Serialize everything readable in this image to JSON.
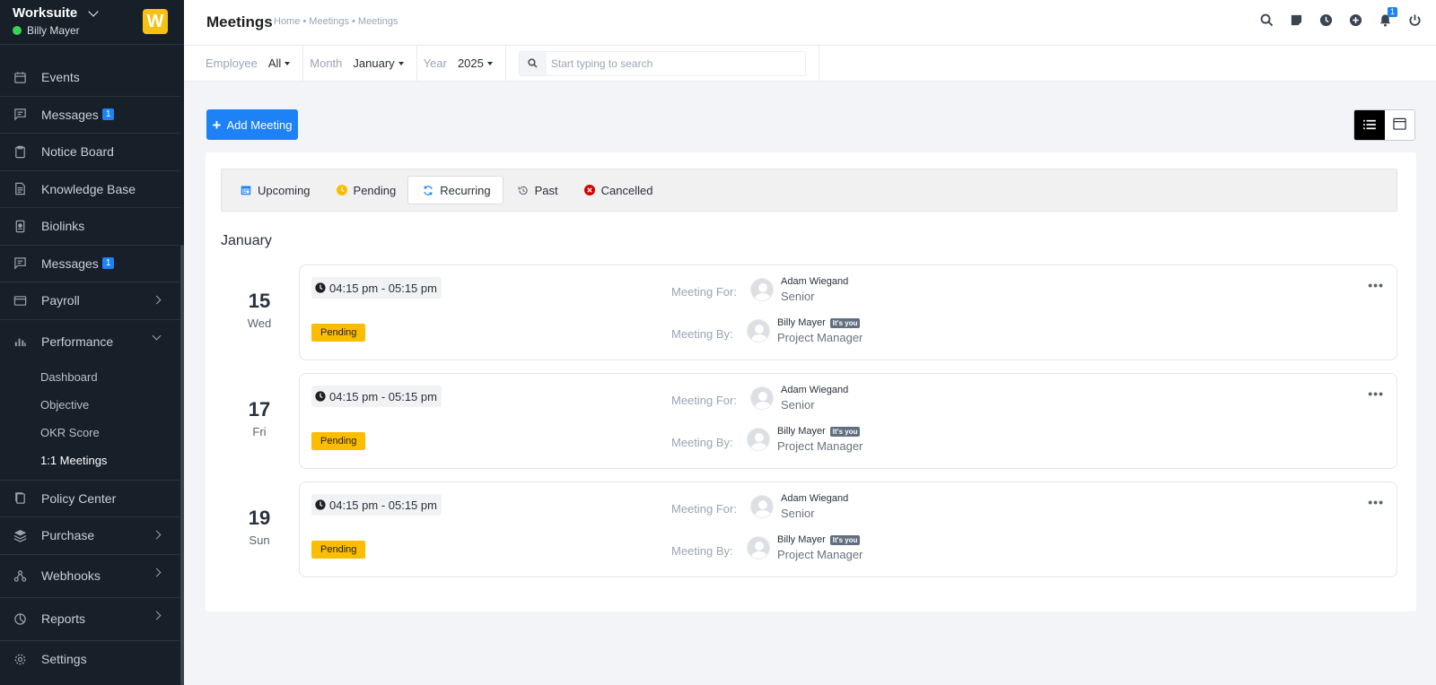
{
  "sidebar": {
    "brand": "Worksuite",
    "user": "Billy Mayer",
    "logo_letter": "W",
    "items": [
      {
        "label": "Events",
        "icon": "calendar-icon"
      },
      {
        "label": "Messages",
        "icon": "message-icon",
        "badge": "1"
      },
      {
        "label": "Notice Board",
        "icon": "clipboard-icon"
      },
      {
        "label": "Knowledge Base",
        "icon": "document-icon"
      },
      {
        "label": "Biolinks",
        "icon": "id-card-icon"
      },
      {
        "label": "Messages",
        "icon": "message-icon",
        "badge": "1"
      },
      {
        "label": "Payroll",
        "icon": "wallet-icon"
      },
      {
        "label": "Performance",
        "icon": "bar-chart-icon"
      },
      {
        "label": "Policy Center",
        "icon": "copy-icon"
      },
      {
        "label": "Purchase",
        "icon": "layers-icon"
      },
      {
        "label": "Webhooks",
        "icon": "webhook-icon"
      },
      {
        "label": "Reports",
        "icon": "pie-chart-icon"
      },
      {
        "label": "Settings",
        "icon": "gear-icon"
      }
    ],
    "performance_sub": [
      "Dashboard",
      "Objective",
      "OKR Score",
      "1:1 Meetings"
    ]
  },
  "header": {
    "title": "Meetings",
    "breadcrumb": "Home • Meetings • Meetings",
    "notification_count": "1"
  },
  "filters": {
    "employee_label": "Employee",
    "employee_value": "All",
    "month_label": "Month",
    "month_value": "January",
    "year_label": "Year",
    "year_value": "2025",
    "search_placeholder": "Start typing to search"
  },
  "actions": {
    "add_meeting": "Add Meeting"
  },
  "tabs": [
    "Upcoming",
    "Pending",
    "Recurring",
    "Past",
    "Cancelled"
  ],
  "month_heading": "January",
  "meetings": [
    {
      "day": "15",
      "weekday": "Wed",
      "time": "04:15 pm - 05:15 pm",
      "status": "Pending",
      "for_label": "Meeting For:",
      "for_name": "Adam Wiegand",
      "for_role": "Senior",
      "by_label": "Meeting By:",
      "by_name": "Billy Mayer",
      "by_badge": "It's you",
      "by_role": "Project Manager"
    },
    {
      "day": "17",
      "weekday": "Fri",
      "time": "04:15 pm - 05:15 pm",
      "status": "Pending",
      "for_label": "Meeting For:",
      "for_name": "Adam Wiegand",
      "for_role": "Senior",
      "by_label": "Meeting By:",
      "by_name": "Billy Mayer",
      "by_badge": "It's you",
      "by_role": "Project Manager"
    },
    {
      "day": "19",
      "weekday": "Sun",
      "time": "04:15 pm - 05:15 pm",
      "status": "Pending",
      "for_label": "Meeting For:",
      "for_name": "Adam Wiegand",
      "for_role": "Senior",
      "by_label": "Meeting By:",
      "by_name": "Billy Mayer",
      "by_badge": "It's you",
      "by_role": "Project Manager"
    }
  ],
  "colors": {
    "sidebar_bg": "#171f29",
    "accent": "#1d82f5",
    "pending": "#fcbd01",
    "cancelled": "#d30000"
  }
}
